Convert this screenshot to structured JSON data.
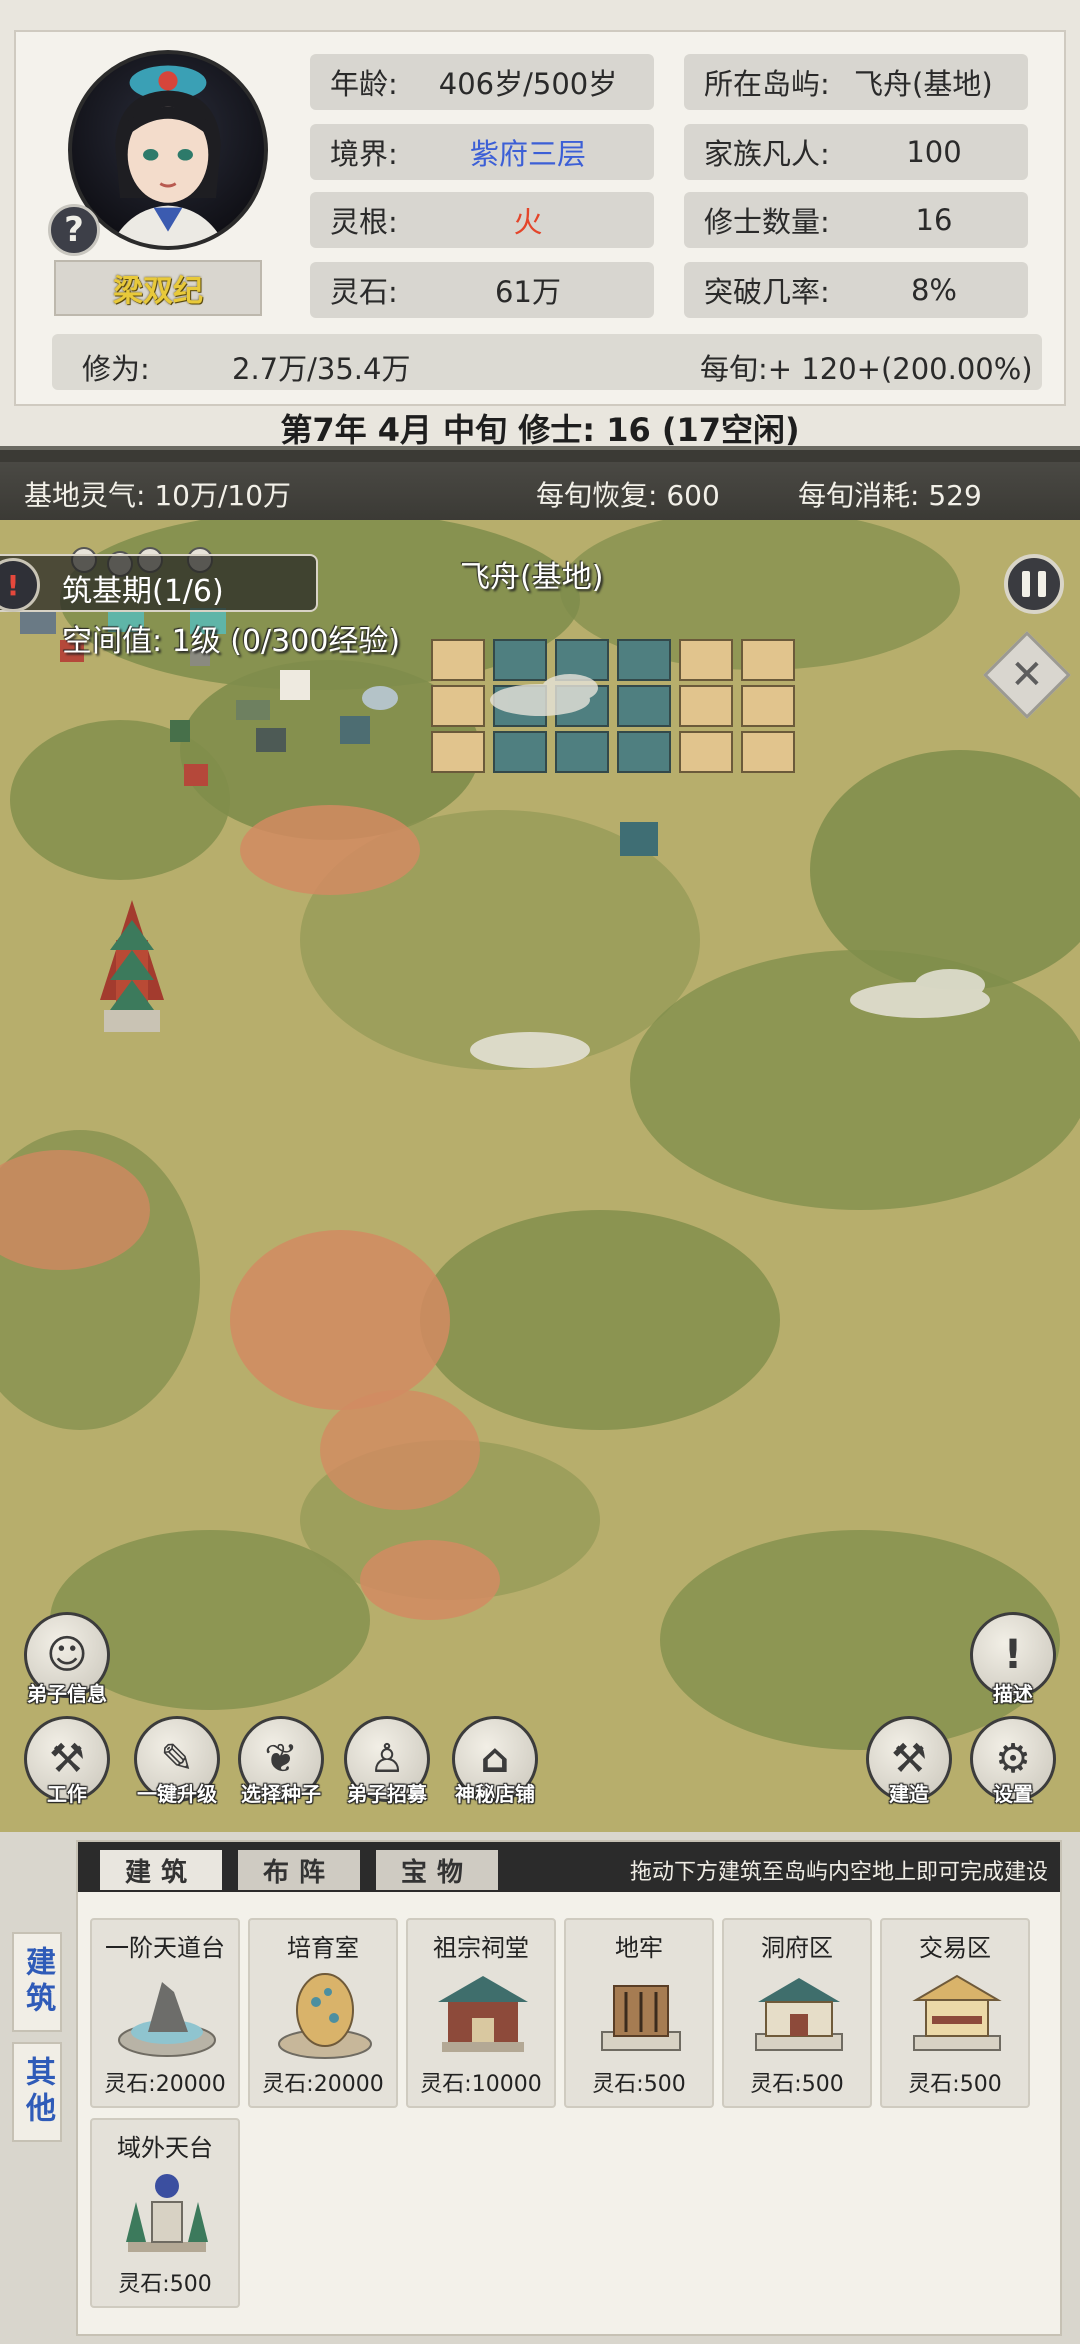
{
  "character": {
    "name": "梁双纪",
    "help_symbol": "?",
    "stats": {
      "age_label": "年龄:",
      "age_value": "406岁/500岁",
      "realm_label": "境界:",
      "realm_value": "紫府三层",
      "root_label": "灵根:",
      "root_value": "火",
      "stone_label": "灵石:",
      "stone_value": "61万",
      "island_label": "所在岛屿:",
      "island_value": "飞舟(基地)",
      "mortals_label": "家族凡人:",
      "mortals_value": "100",
      "cultivators_label": "修士数量:",
      "cultivators_value": "16",
      "breakthrough_label": "突破几率:",
      "breakthrough_value": "8%"
    },
    "cultivation_label": "修为:",
    "cultivation_value": "2.7万/35.4万",
    "per_period": "每旬:+ 120+(200.00%)",
    "colors": {
      "realm": "#3c5fd6",
      "root": "#e4452a",
      "name": "#e8c93a"
    }
  },
  "date_line": "第7年 4月 中旬    修士: 16 (17空闲)",
  "status": {
    "base_qi": "基地灵气: 10万/10万",
    "recovery": "每旬恢复: 600",
    "consumption": "每旬消耗: 529"
  },
  "map": {
    "stage": "筑基期(1/6)",
    "stage_icon": "!",
    "location_name": "飞舟(基地)",
    "space_value": "空间值: 1级 (0/300经验)",
    "close_symbol": "✕"
  },
  "actions": [
    {
      "id": "disciple-info",
      "label": "弟子信息",
      "icon": "person-icon"
    },
    {
      "id": "work",
      "label": "工作",
      "icon": "hoe-icon"
    },
    {
      "id": "upgrade",
      "label": "一键升级",
      "icon": "scroll-icon"
    },
    {
      "id": "seeds",
      "label": "选择种子",
      "icon": "sprout-icon"
    },
    {
      "id": "recruit",
      "label": "弟子招募",
      "icon": "recruit-icon"
    },
    {
      "id": "shop",
      "label": "神秘店铺",
      "icon": "shop-icon"
    },
    {
      "id": "describe",
      "label": "描述",
      "icon": "exclamation-icon",
      "symbol": "!"
    },
    {
      "id": "build",
      "label": "建造",
      "icon": "hammer-icon"
    },
    {
      "id": "settings",
      "label": "设置",
      "icon": "gear-icon"
    }
  ],
  "build_panel": {
    "side_tabs": [
      "建筑",
      "其他"
    ],
    "tabs": [
      "建筑",
      "布阵",
      "宝物"
    ],
    "hint": "拖动下方建筑至岛屿内空地上即可完成建设",
    "items": [
      {
        "name": "一阶天道台",
        "cost": "灵石:20000"
      },
      {
        "name": "培育室",
        "cost": "灵石:20000"
      },
      {
        "name": "祖宗祠堂",
        "cost": "灵石:10000"
      },
      {
        "name": "地牢",
        "cost": "灵石:500"
      },
      {
        "name": "洞府区",
        "cost": "灵石:500"
      },
      {
        "name": "交易区",
        "cost": "灵石:500"
      },
      {
        "name": "域外天台",
        "cost": "灵石:500"
      }
    ]
  }
}
